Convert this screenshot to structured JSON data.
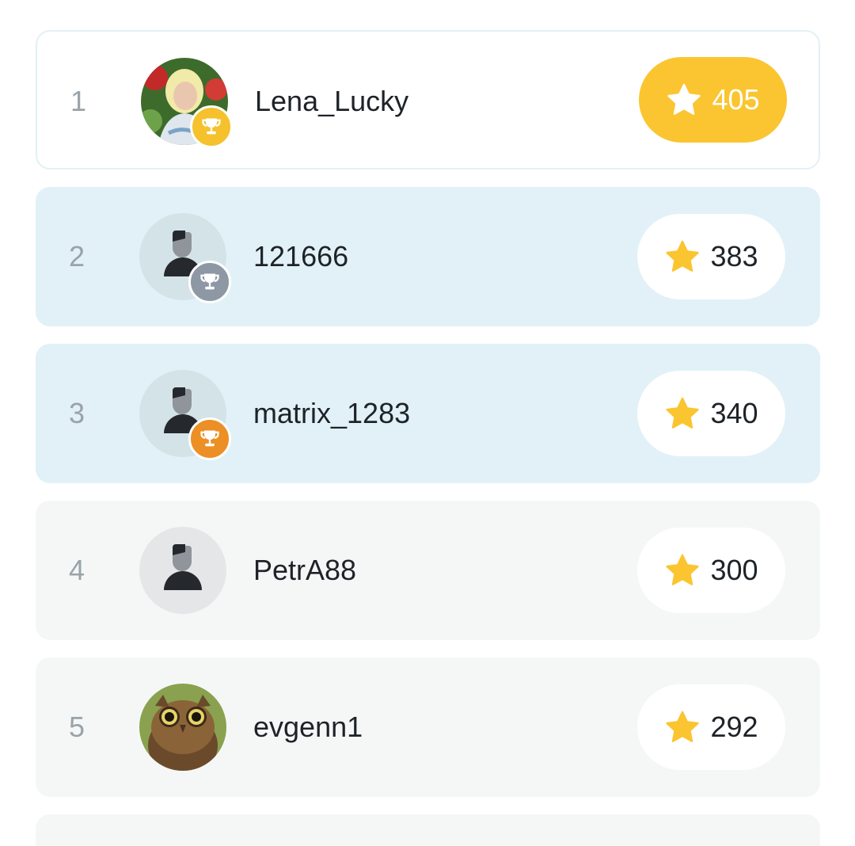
{
  "leaderboard": {
    "rows": [
      {
        "rank": "1",
        "name": "Lena_Lucky",
        "score": "405",
        "medal": "gold",
        "avatar": "photo-woman-flowers"
      },
      {
        "rank": "2",
        "name": "121666",
        "score": "383",
        "medal": "silver",
        "avatar": "default-user"
      },
      {
        "rank": "3",
        "name": "matrix_1283",
        "score": "340",
        "medal": "bronze",
        "avatar": "default-user"
      },
      {
        "rank": "4",
        "name": "PetrA88",
        "score": "300",
        "medal": "",
        "avatar": "default-user"
      },
      {
        "rank": "5",
        "name": "evgenn1",
        "score": "292",
        "medal": "",
        "avatar": "photo-owl"
      }
    ]
  },
  "colors": {
    "gold": "#f5c12c",
    "silver": "#8e97a4",
    "bronze": "#ec8f24",
    "star": "#fbc531",
    "podium_row": "#e1f1f7",
    "plain_row": "#f5f7f7"
  },
  "icons": {
    "score": "star-icon",
    "medal": "trophy-icon",
    "default_avatar": "user-silhouette-icon"
  }
}
